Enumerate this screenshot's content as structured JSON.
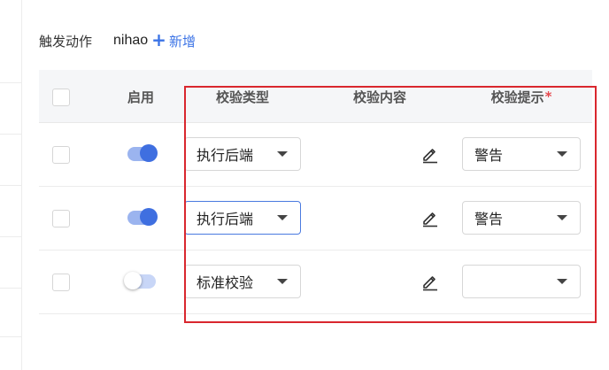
{
  "trigger": {
    "label": "触发动作",
    "value": "nihao",
    "add_label": "新增"
  },
  "table": {
    "headers": {
      "enabled": "启用",
      "check_type": "校验类型",
      "check_content": "校验内容",
      "check_tip": "校验提示",
      "required_mark": "*"
    },
    "rows": [
      {
        "enabled": true,
        "check_type": "执行后端",
        "check_tip": "警告",
        "focused": false
      },
      {
        "enabled": true,
        "check_type": "执行后端",
        "check_tip": "警告",
        "focused": true
      },
      {
        "enabled": false,
        "check_type": "标准校验",
        "check_tip": "",
        "focused": false
      }
    ]
  },
  "colors": {
    "accent": "#3f6fe0",
    "highlight": "#d9272e",
    "required": "#e5484d"
  },
  "icons": [
    "plus-icon",
    "edit-icon",
    "chevron-down-icon"
  ]
}
